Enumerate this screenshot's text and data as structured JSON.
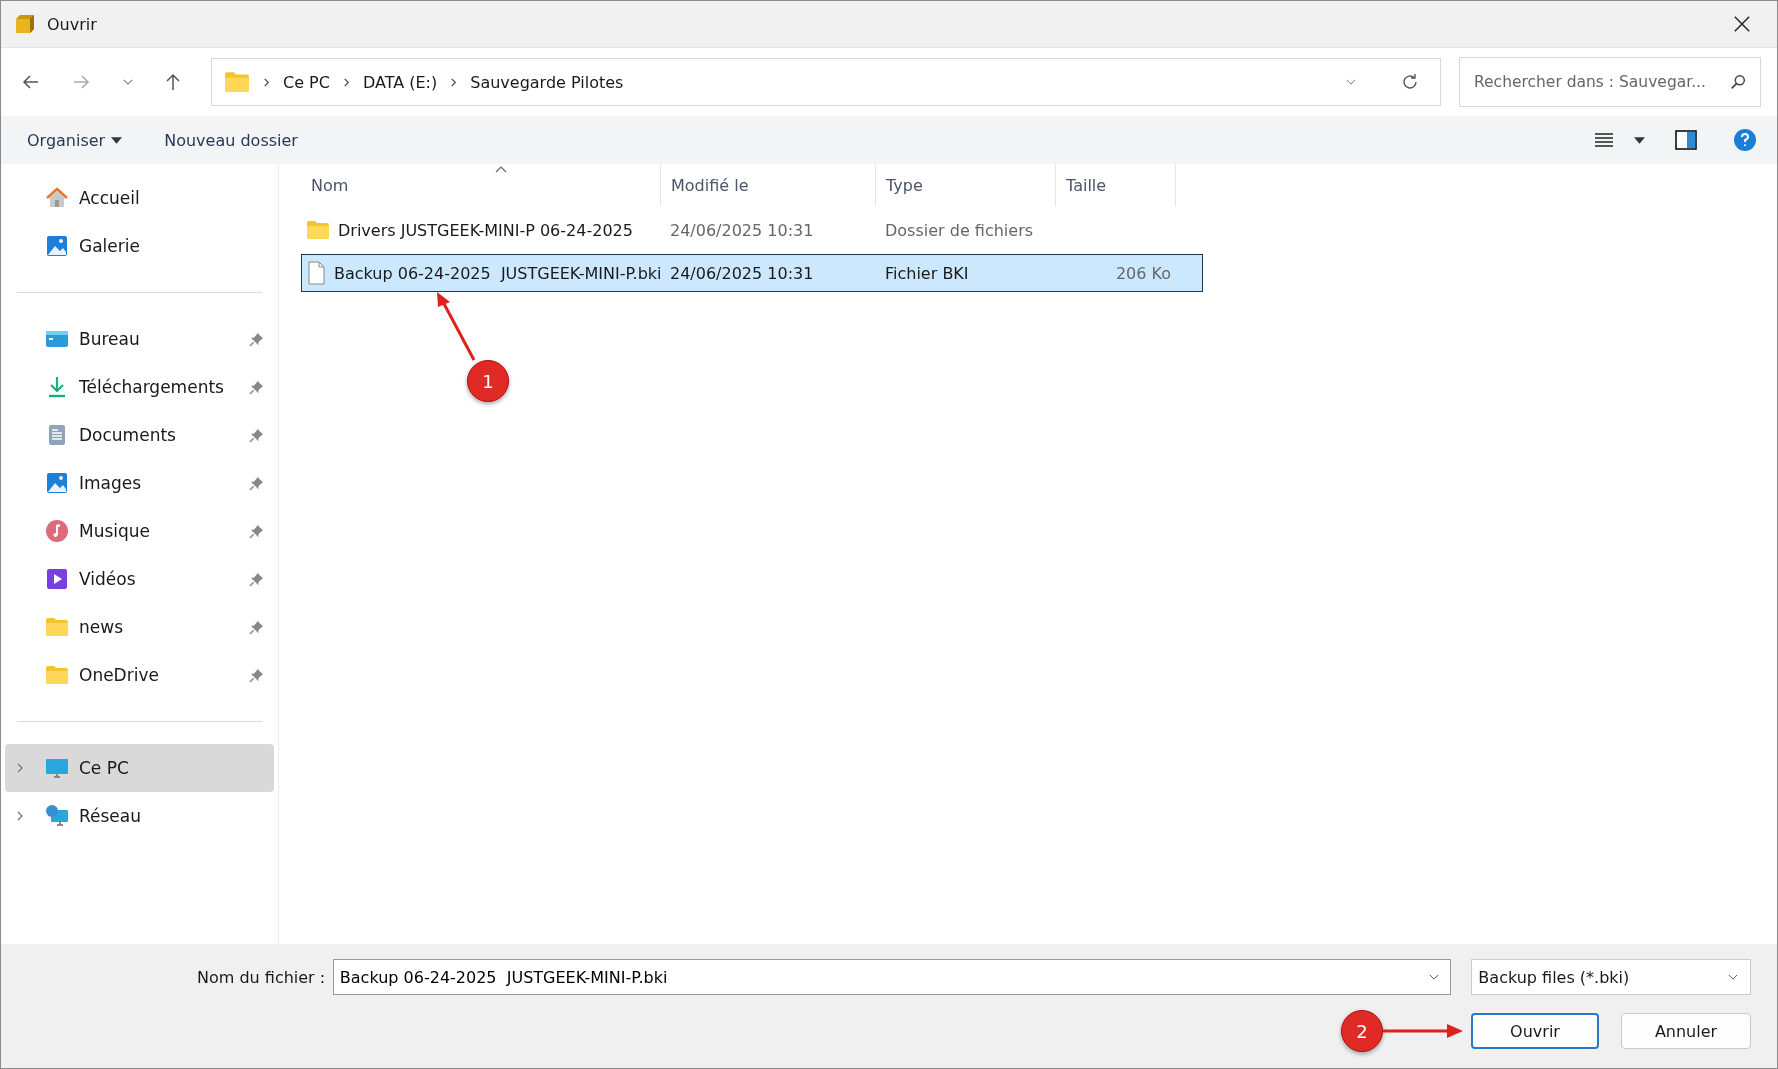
{
  "window": {
    "title": "Ouvrir"
  },
  "address_bar": {
    "path": [
      "Ce PC",
      "DATA (E:)",
      "Sauvegarde Pilotes"
    ]
  },
  "search": {
    "placeholder": "Rechercher dans : Sauvegar..."
  },
  "toolbar": {
    "organize": "Organiser",
    "new_folder": "Nouveau dossier"
  },
  "sidebar": {
    "groups": [
      [
        {
          "label": "Accueil",
          "kind": "home",
          "pinned": false,
          "expandable": false,
          "selected": false
        },
        {
          "label": "Galerie",
          "kind": "gallery",
          "pinned": false,
          "expandable": false,
          "selected": false
        }
      ],
      [
        {
          "label": "Bureau",
          "kind": "desktop",
          "pinned": true,
          "expandable": false,
          "selected": false
        },
        {
          "label": "Téléchargements",
          "kind": "download",
          "pinned": true,
          "expandable": false,
          "selected": false
        },
        {
          "label": "Documents",
          "kind": "documents",
          "pinned": true,
          "expandable": false,
          "selected": false
        },
        {
          "label": "Images",
          "kind": "gallery",
          "pinned": true,
          "expandable": false,
          "selected": false
        },
        {
          "label": "Musique",
          "kind": "music",
          "pinned": true,
          "expandable": false,
          "selected": false
        },
        {
          "label": "Vidéos",
          "kind": "video",
          "pinned": true,
          "expandable": false,
          "selected": false
        },
        {
          "label": "news",
          "kind": "folder",
          "pinned": true,
          "expandable": false,
          "selected": false
        },
        {
          "label": "OneDrive",
          "kind": "folder",
          "pinned": true,
          "expandable": false,
          "selected": false
        }
      ],
      [
        {
          "label": "Ce PC",
          "kind": "pc",
          "pinned": false,
          "expandable": true,
          "selected": true
        },
        {
          "label": "Réseau",
          "kind": "network",
          "pinned": false,
          "expandable": true,
          "selected": false
        }
      ]
    ]
  },
  "table": {
    "columns": [
      "Nom",
      "Modifié le",
      "Type",
      "Taille"
    ],
    "rows": [
      {
        "kind": "folder",
        "name": "Drivers JUSTGEEK-MINI-P 06-24-2025",
        "modified": "24/06/2025 10:31",
        "type": "Dossier de fichiers",
        "size": "",
        "selected": false
      },
      {
        "kind": "file",
        "name": "Backup 06-24-2025  JUSTGEEK-MINI-P.bki",
        "modified": "24/06/2025 10:31",
        "type": "Fichier BKI",
        "size": "206 Ko",
        "selected": true
      }
    ]
  },
  "footer": {
    "filename_label": "Nom du fichier :",
    "filename_value": "Backup 06-24-2025  JUSTGEEK-MINI-P.bki",
    "filter": "Backup files (*.bki)",
    "buttons": [
      {
        "label": "Ouvrir",
        "kind": "primary"
      },
      {
        "label": "Annuler",
        "kind": "normal"
      }
    ]
  },
  "annotations": [
    {
      "label": "1"
    },
    {
      "label": "2"
    }
  ]
}
